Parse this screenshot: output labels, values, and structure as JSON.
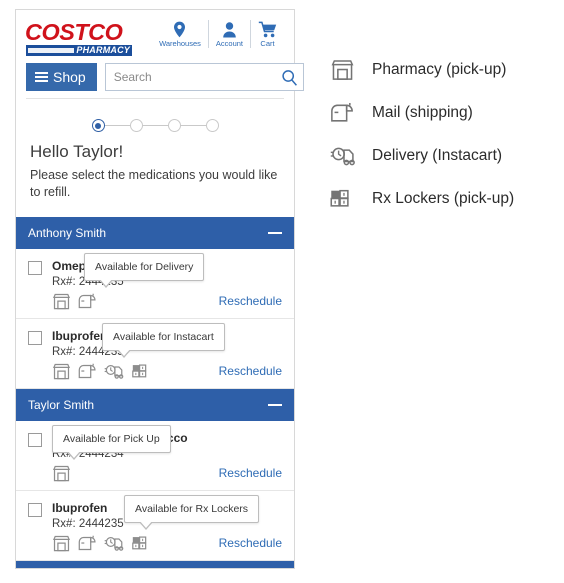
{
  "header": {
    "logo_wordmark": "COSTCO",
    "logo_sub": "PHARMACY",
    "nav": [
      {
        "label": "Warehouses",
        "icon": "location-pin-icon"
      },
      {
        "label": "Account",
        "icon": "person-icon"
      },
      {
        "label": "Cart",
        "icon": "cart-icon"
      }
    ],
    "shop_label": "Shop",
    "search_placeholder": "Search",
    "search_value": ""
  },
  "stepper": {
    "total": 4,
    "active_index": 0
  },
  "greeting": {
    "title": "Hello Taylor!",
    "subtitle": "Please select the medications you would like to refill."
  },
  "groups": [
    {
      "patient": "Anthony Smith",
      "collapse_label": "—",
      "medications": [
        {
          "name": "Omeprazole 20mg Costco",
          "rx": "Rx#: 2444235",
          "icons": [
            "pharmacy-icon",
            "mail-icon"
          ],
          "reschedule_label": "Reschedule",
          "tooltip": "Available for Delivery"
        },
        {
          "name": "Ibuprofen",
          "rx": "Rx#: 2444235",
          "icons": [
            "pharmacy-icon",
            "mail-icon",
            "delivery-icon",
            "locker-icon"
          ],
          "reschedule_label": "Reschedule",
          "tooltip": "Available for Instacart"
        }
      ]
    },
    {
      "patient": "Taylor Smith",
      "collapse_label": "—",
      "medications": [
        {
          "name": "Omeprazole 20mg Acco",
          "rx": "Rx#: 2444234",
          "icons": [
            "pharmacy-icon"
          ],
          "reschedule_label": "Reschedule",
          "tooltip": "Available for Pick Up"
        },
        {
          "name": "Ibuprofen",
          "rx": "Rx#: 2444235",
          "icons": [
            "pharmacy-icon",
            "mail-icon",
            "delivery-icon",
            "locker-icon"
          ],
          "reschedule_label": "Reschedule",
          "tooltip": "Available for Rx Lockers"
        }
      ]
    }
  ],
  "legend": [
    {
      "icon": "pharmacy-icon",
      "label": "Pharmacy (pick-up)"
    },
    {
      "icon": "mail-icon",
      "label": "Mail (shipping)"
    },
    {
      "icon": "delivery-icon",
      "label": "Delivery (Instacart)"
    },
    {
      "icon": "locker-icon",
      "label": "Rx Lockers (pick-up)"
    }
  ],
  "colors": {
    "costco_red": "#d0121b",
    "costco_blue": "#1b4e9b",
    "header_blue": "#2e5fa8",
    "link_blue": "#2f6cb5",
    "shop_blue": "#3569ab"
  }
}
